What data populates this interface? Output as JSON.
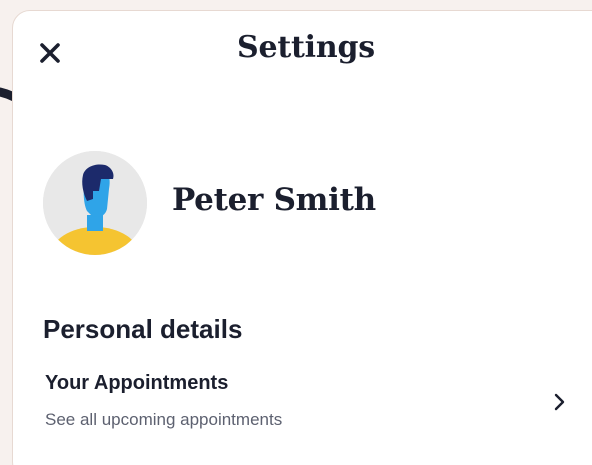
{
  "header": {
    "title": "Settings",
    "close_icon": "close-icon"
  },
  "annotation": {
    "icon": "hand-drawn-arrow-icon"
  },
  "profile": {
    "name": "Peter Smith",
    "avatar_icon": "user-avatar-icon"
  },
  "personal_details": {
    "heading": "Personal details",
    "items": [
      {
        "title": "Your Appointments",
        "subtitle": "See all upcoming appointments",
        "icon": "chevron-right-icon"
      }
    ]
  },
  "colors": {
    "text": "#1b1f2e",
    "subtext": "#5d6170",
    "avatar_bg": "#e8e8e8",
    "avatar_shirt": "#f5c431",
    "avatar_skin": "#2fa4e8",
    "avatar_hair": "#1c2a6b",
    "annotation": "#1b1f2e"
  }
}
